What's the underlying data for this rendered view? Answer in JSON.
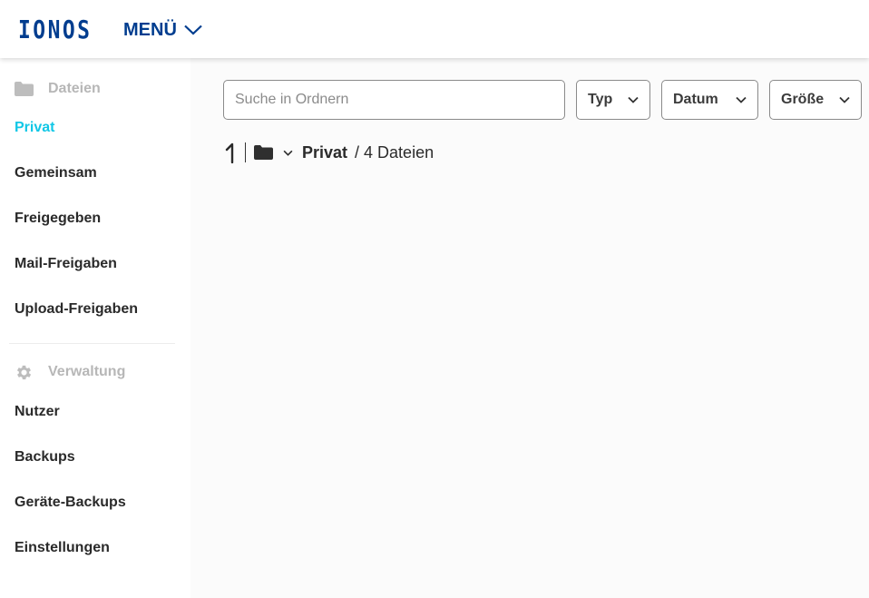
{
  "header": {
    "logo": "IONOS",
    "menu_label": "MENÜ"
  },
  "sidebar": {
    "files_section": "Dateien",
    "files_items": [
      "Privat",
      "Gemeinsam",
      "Freigegeben",
      "Mail-Freigaben",
      "Upload-Freigaben"
    ],
    "active_item": "Privat",
    "admin_section": "Verwaltung",
    "admin_items": [
      "Nutzer",
      "Backups",
      "Geräte-Backups",
      "Einstellungen"
    ]
  },
  "toolbar": {
    "search_placeholder": "Suche in Ordnern",
    "search_value": "",
    "filter_type": "Typ",
    "filter_date": "Datum",
    "filter_size": "Größe"
  },
  "breadcrumb": {
    "current": "Privat",
    "count": "/ 4 Dateien"
  },
  "colors": {
    "brand": "#003d8f",
    "active": "#11c7e6"
  },
  "icons": {
    "section_files": "folder-icon",
    "section_admin": "gear-icon",
    "up": "arrow-up-icon",
    "breadcrumb_folder": "folder-icon",
    "dropdown": "chevron-down-icon"
  }
}
